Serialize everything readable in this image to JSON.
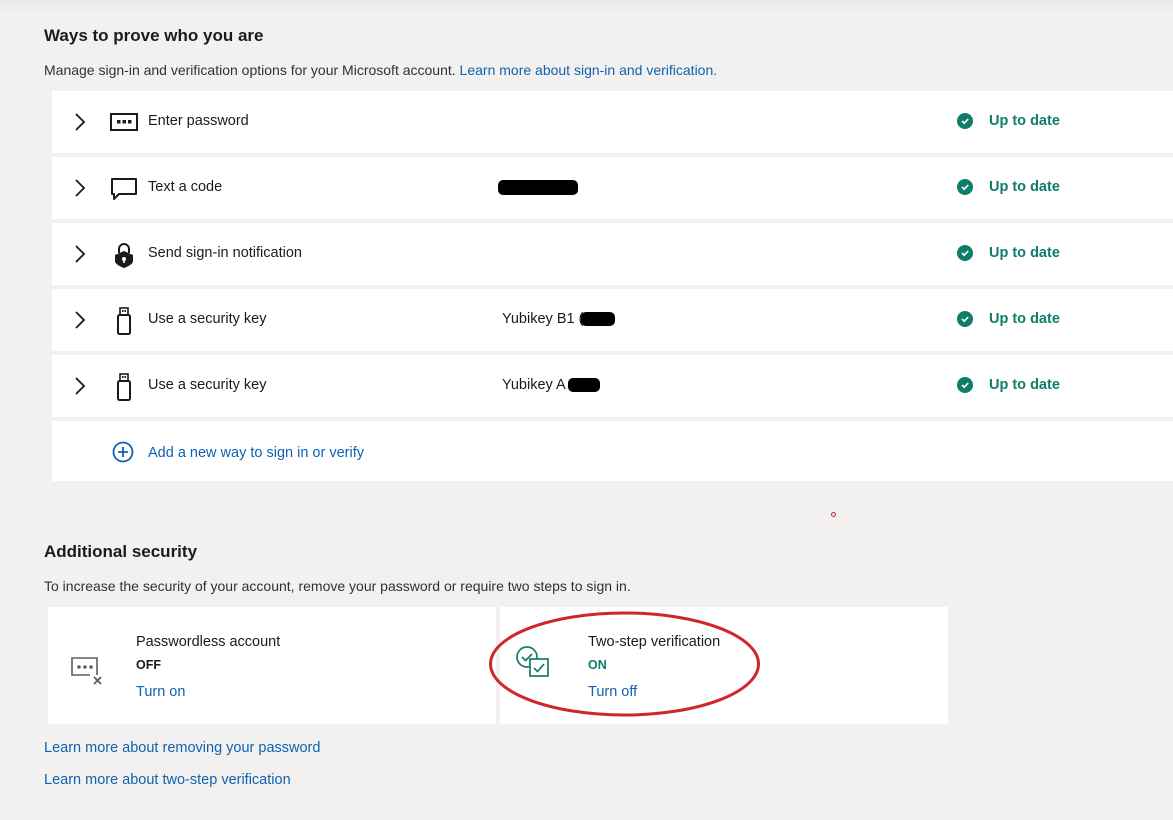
{
  "section1": {
    "title": "Ways to prove who you are",
    "description": "Manage sign-in and verification options for your Microsoft account.",
    "learn_link": "Learn more about sign-in and verification."
  },
  "methods": [
    {
      "icon": "password-icon",
      "label": "Enter password",
      "detail": "",
      "status": "Up to date"
    },
    {
      "icon": "chat-icon",
      "label": "Text a code",
      "detail": "",
      "status": "Up to date"
    },
    {
      "icon": "lock-icon",
      "label": "Send sign-in notification",
      "detail": "",
      "status": "Up to date"
    },
    {
      "icon": "usb-key-icon",
      "label": "Use a security key",
      "detail": "Yubikey B1 (",
      "status": "Up to date"
    },
    {
      "icon": "usb-key-icon",
      "label": "Use a security key",
      "detail": "Yubikey A",
      "status": "Up to date"
    }
  ],
  "add_method": {
    "icon": "plus-circle-icon",
    "label": "Add a new way to sign in or verify"
  },
  "section2": {
    "title": "Additional security",
    "description": "To increase the security of your account, remove your password or require two steps to sign in."
  },
  "cards": [
    {
      "icon": "passwordless-icon",
      "title": "Passwordless account",
      "state": "OFF",
      "action": "Turn on",
      "state_color": "#1b1b1b"
    },
    {
      "icon": "two-step-icon",
      "title": "Two-step verification",
      "state": "ON",
      "action": "Turn off",
      "state_color": "#107c6a"
    }
  ],
  "bottom_links": {
    "remove_password": "Learn more about removing your password",
    "two_step": "Learn more about two-step verification"
  },
  "colors": {
    "accent": "#0f62b0",
    "success": "#107c6a",
    "annotation": "#d0262a"
  }
}
